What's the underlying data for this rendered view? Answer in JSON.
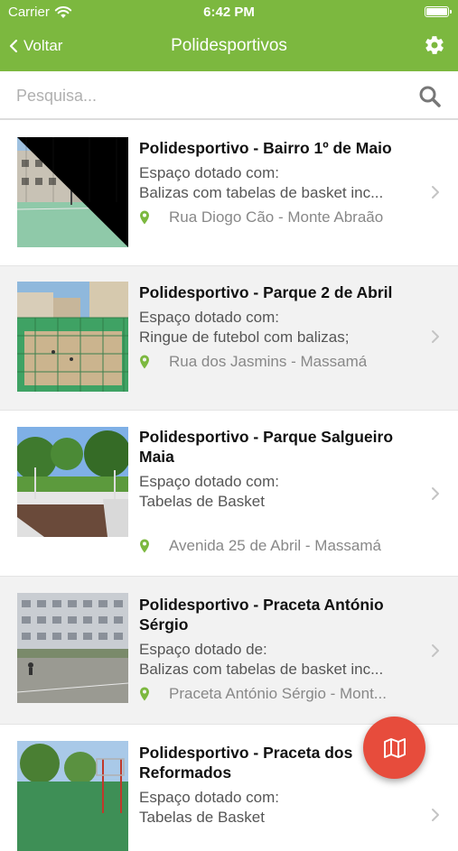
{
  "status": {
    "carrier": "Carrier",
    "time": "6:42 PM"
  },
  "nav": {
    "back_label": "Voltar",
    "title": "Polidesportivos"
  },
  "search": {
    "placeholder": "Pesquisa..."
  },
  "colors": {
    "brand": "#7cb83f",
    "fab": "#e74c3c",
    "pin": "#7cb83f"
  },
  "items": [
    {
      "name": "Polidesportivo - Bairro 1º de Maio",
      "desc1": "Espaço dotado com:",
      "desc2": "Balizas com tabelas de basket inc...",
      "address": "Rua Diogo Cão - Monte Abraão"
    },
    {
      "name": "Polidesportivo - Parque 2 de Abril",
      "desc1": "Espaço dotado com:",
      "desc2": "Ringue de futebol com balizas;",
      "address": "Rua dos Jasmins - Massamá"
    },
    {
      "name": "Polidesportivo - Parque Salgueiro Maia",
      "desc1": "Espaço dotado com:",
      "desc2": "Tabelas de Basket",
      "address": "Avenida 25 de Abril - Massamá"
    },
    {
      "name": "Polidesportivo - Praceta António Sérgio",
      "desc1": "Espaço dotado de:",
      "desc2": "Balizas com tabelas de basket inc...",
      "address": "Praceta António Sérgio - Mont..."
    },
    {
      "name": "Polidesportivo - Praceta dos Reformados",
      "desc1": "Espaço dotado com:",
      "desc2": "Tabelas de Basket",
      "address": ""
    }
  ],
  "icons": {
    "wifi": "wifi-icon",
    "battery": "battery-icon",
    "back": "chevron-left-icon",
    "settings": "gear-icon",
    "search": "search-icon",
    "pin": "map-pin-icon",
    "chevron": "chevron-right-icon",
    "map": "map-icon"
  }
}
